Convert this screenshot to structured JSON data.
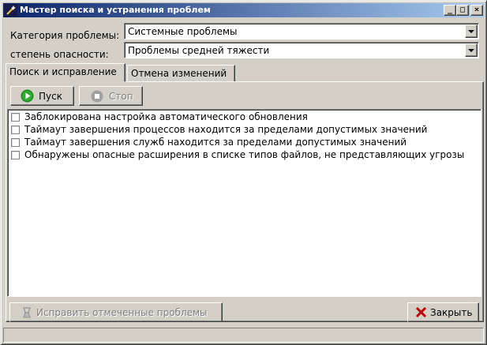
{
  "window": {
    "title": "Мастер поиска и устранения проблем",
    "controls": {
      "minimize": "_",
      "maximize": "□",
      "close": "×"
    }
  },
  "filters": {
    "category_label": "Категория проблемы:",
    "category_value": "Системные проблемы",
    "severity_label": "степень опасности:",
    "severity_value": "Проблемы средней тяжести"
  },
  "tabs": [
    {
      "label": "Поиск и исправление",
      "active": true
    },
    {
      "label": "Отмена изменений",
      "active": false
    }
  ],
  "toolbar": {
    "start_label": "Пуск",
    "stop_label": "Стоп"
  },
  "problems": [
    {
      "label": "Заблокирована настройка автоматического обновления",
      "checked": false
    },
    {
      "label": "Таймаут завершения процессов находится за пределами допустимых значений",
      "checked": false
    },
    {
      "label": "Таймаут завершения служб находится за пределами допустимых значений",
      "checked": false
    },
    {
      "label": "Обнаружены опасные расширения в списке типов файлов, не представляющих угрозы",
      "checked": false
    }
  ],
  "footer": {
    "fix_label": "Исправить отмеченные проблемы",
    "close_label": "Закрыть"
  },
  "colors": {
    "face": "#d4d0c8",
    "title_start": "#0a246a",
    "title_end": "#a6caf0",
    "play_icon": "#1a8a1a",
    "close_icon": "#c00000"
  },
  "icons": {
    "app": "wand-icon",
    "start": "play-icon",
    "stop": "stop-icon",
    "fix": "broom-icon",
    "close": "x-icon"
  }
}
